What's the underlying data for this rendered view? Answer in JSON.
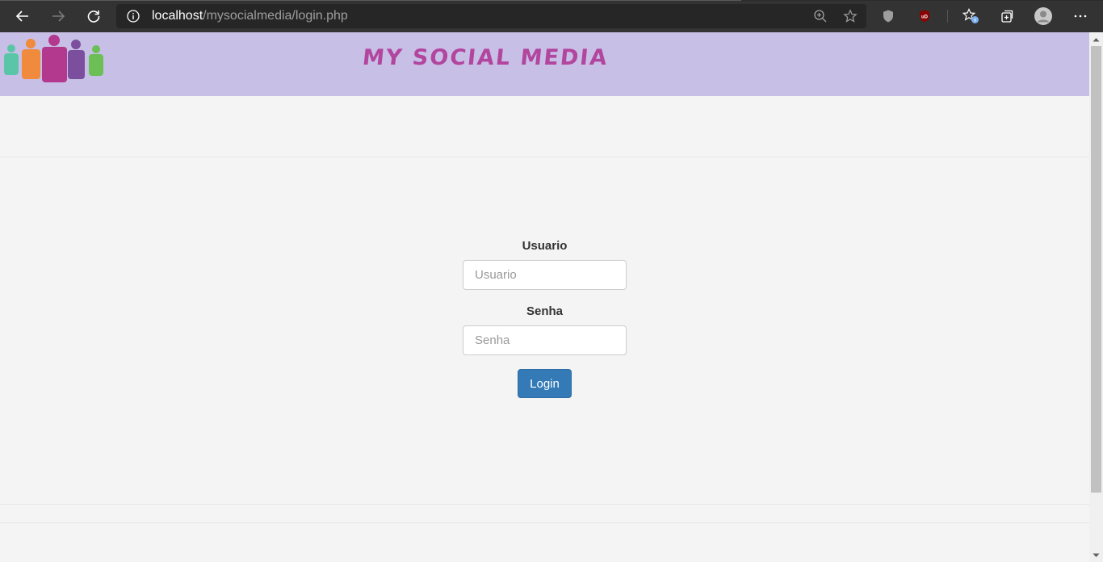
{
  "browser": {
    "url_host": "localhost",
    "url_path": "/mysocialmedia/login.php",
    "icons": {
      "back": "back-arrow-icon",
      "forward": "forward-arrow-icon",
      "reload": "reload-icon",
      "info": "info-icon",
      "zoom": "zoom-icon",
      "favorite": "star-icon",
      "shield": "shield-icon",
      "ublock": "ublock-icon",
      "favorites": "favorites-icon",
      "collections": "collections-icon",
      "profile": "profile-icon",
      "menu": "more-menu-icon"
    },
    "ublock_badge": "uD"
  },
  "header": {
    "site_title": "MY SOCIAL MEDIA",
    "banner_color": "#c8bfe6",
    "title_color": "#b2459e"
  },
  "login_form": {
    "username_label": "Usuario",
    "username_placeholder": "Usuario",
    "username_value": "",
    "password_label": "Senha",
    "password_placeholder": "Senha",
    "password_value": "",
    "login_button": "Login",
    "button_color": "#337ab7"
  }
}
